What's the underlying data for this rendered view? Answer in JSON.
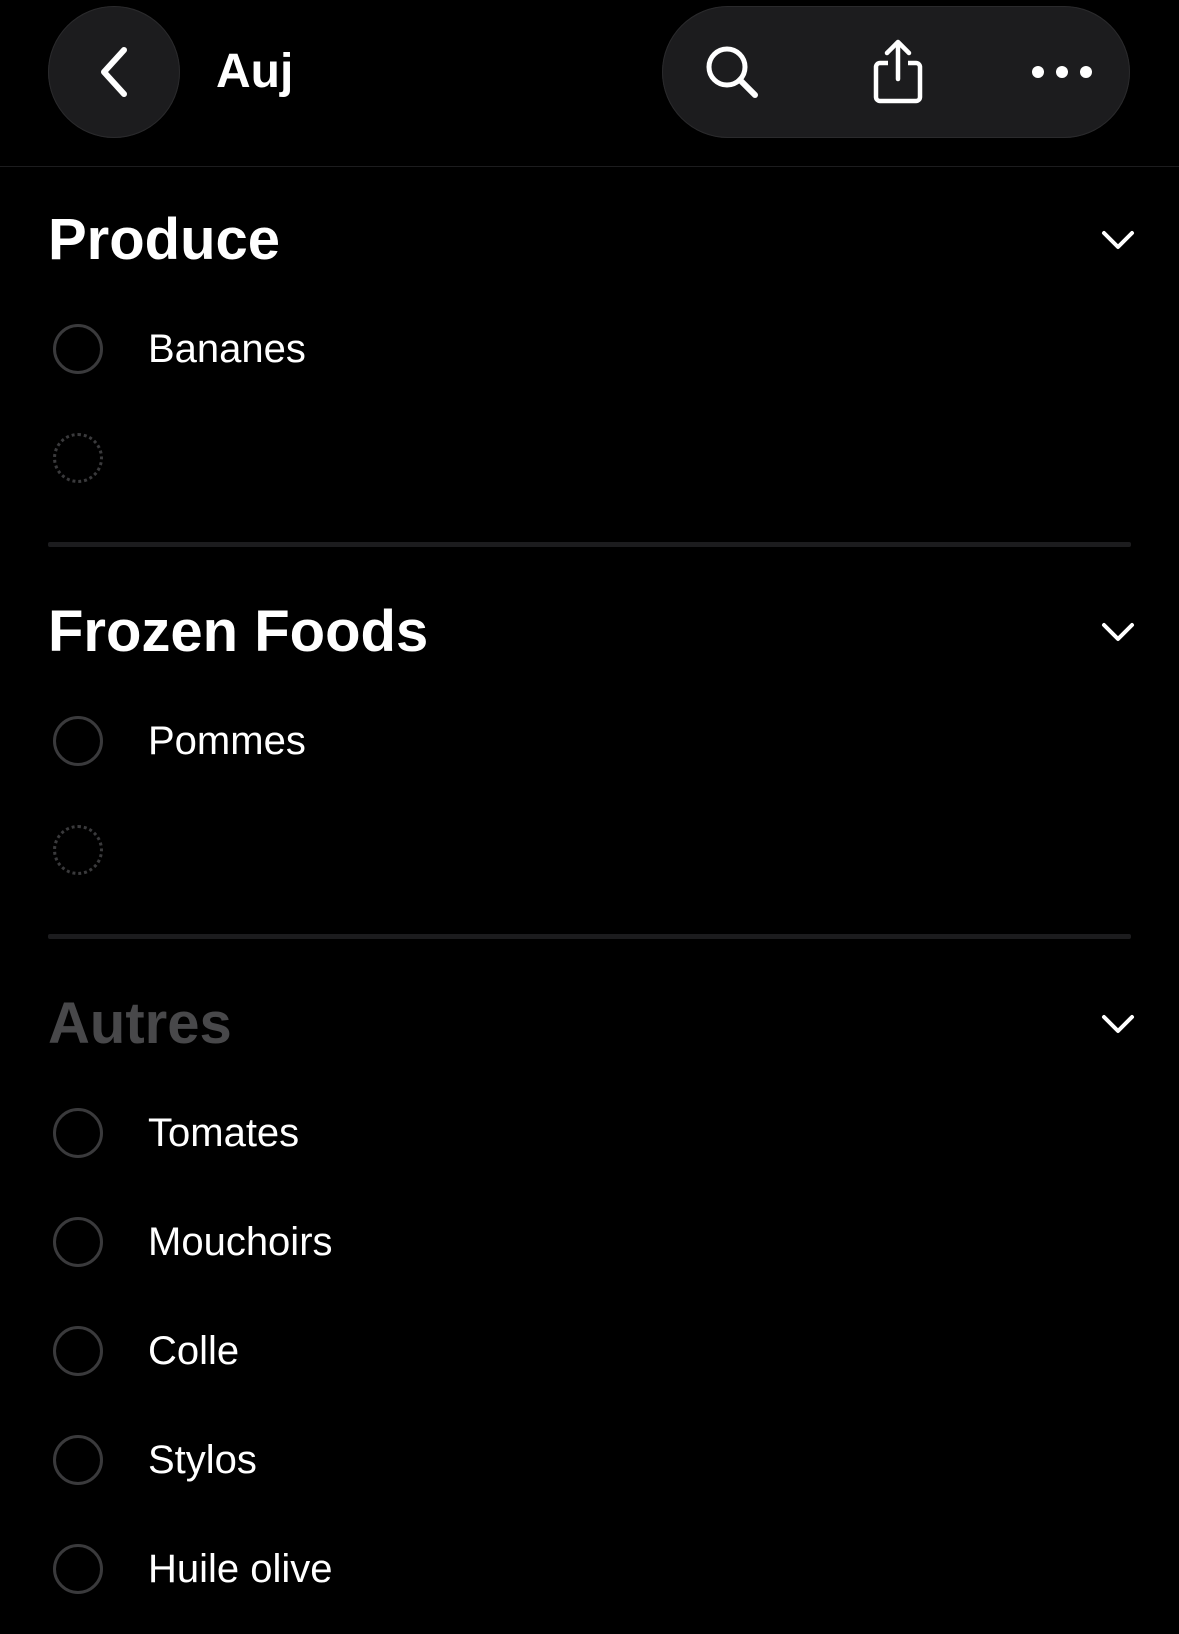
{
  "header": {
    "title": "Auj",
    "back_icon": "chevron-left-icon",
    "actions": [
      "search-icon",
      "share-icon",
      "more-icon"
    ]
  },
  "sections": [
    {
      "title": "Produce",
      "items": [
        "Bananes"
      ]
    },
    {
      "title": "Frozen Foods",
      "items": [
        "Pommes"
      ]
    },
    {
      "title": "Autres",
      "items": [
        "Tomates",
        "Mouchoirs",
        "Colle",
        "Stylos",
        "Huile olive"
      ]
    }
  ],
  "colors": {
    "background": "#000000",
    "control_fill": "#1c1c1e",
    "circle_stroke": "#3a3a3c",
    "dim_title": "#48484a",
    "text": "#ffffff"
  }
}
